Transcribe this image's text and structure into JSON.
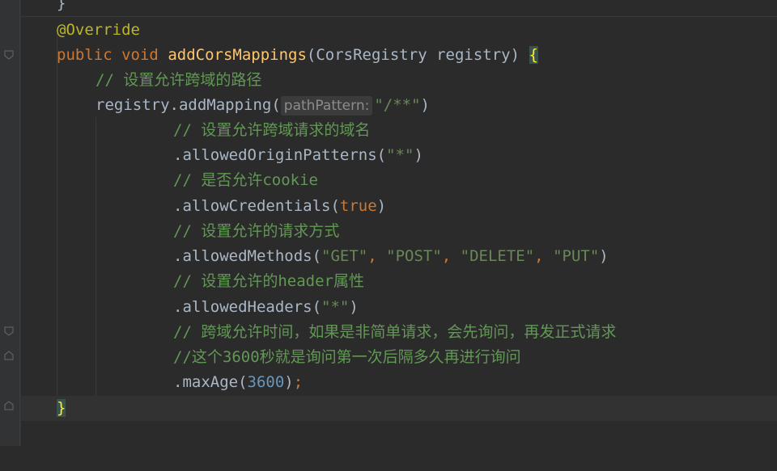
{
  "editor": {
    "lines": {
      "l0": {
        "brace": "}"
      },
      "l1": {
        "annotation": "@Override"
      },
      "l2": {
        "public": "public",
        "void": "void",
        "method": "addCorsMappings",
        "open_paren": "(",
        "ptype": "CorsRegistry",
        "pname": "registry",
        "close_paren": ")",
        "brace": "{"
      },
      "l3": {
        "comment": "// 设置允许跨域的路径"
      },
      "l4": {
        "call": "registry.addMapping(",
        "hint": "pathPattern:",
        "arg": "\"/**\"",
        "close": ")"
      },
      "l5": {
        "comment": "// 设置允许跨域请求的域名"
      },
      "l6": {
        "call": ".allowedOriginPatterns(",
        "arg": "\"*\"",
        "close": ")"
      },
      "l7": {
        "comment": "// 是否允许cookie"
      },
      "l8": {
        "call": ".allowCredentials(",
        "arg": "true",
        "close": ")"
      },
      "l9": {
        "comment": "// 设置允许的请求方式"
      },
      "l10": {
        "call": ".allowedMethods(",
        "a1": "\"GET\"",
        "c1": ", ",
        "a2": "\"POST\"",
        "c2": ", ",
        "a3": "\"DELETE\"",
        "c3": ", ",
        "a4": "\"PUT\"",
        "close": ")"
      },
      "l11": {
        "comment": "// 设置允许的header属性"
      },
      "l12": {
        "call": ".allowedHeaders(",
        "arg": "\"*\"",
        "close": ")"
      },
      "l13": {
        "comment": "// 跨域允许时间，如果是非简单请求，会先询问，再发正式请求"
      },
      "l14": {
        "comment": "//这个3600秒就是询问第一次后隔多久再进行询问"
      },
      "l15": {
        "call": ".maxAge(",
        "arg": "3600",
        "close": ")",
        "semi": ";"
      },
      "l16": {
        "brace": "}"
      }
    }
  },
  "colors": {
    "background": "#2b2b2b",
    "keyword": "#cc7832",
    "method": "#ffc66d",
    "string": "#6a8759",
    "comment": "#629755",
    "number": "#6897bb",
    "annotation": "#bbb529"
  },
  "icons": {
    "fold_markers": [
      "fold-collapse-icon",
      "fold-end-icon"
    ]
  }
}
